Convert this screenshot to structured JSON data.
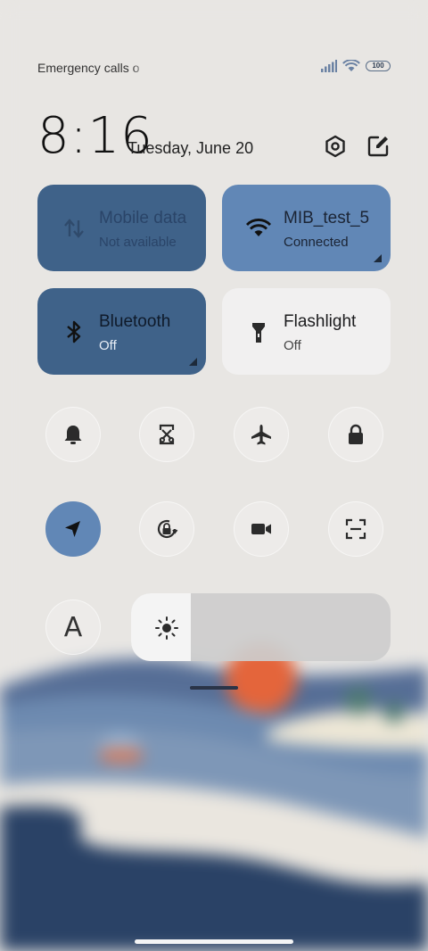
{
  "status_bar": {
    "carrier_text": "Emergency calls o",
    "battery_level": "100",
    "signal_icon": "signal-bars-icon",
    "wifi_icon": "wifi-icon"
  },
  "header": {
    "time": "8:16",
    "date": "Tuesday, June 20",
    "settings_icon": "settings-hex-icon",
    "edit_icon": "edit-icon"
  },
  "tiles": [
    {
      "label": "Mobile data",
      "sub": "Not available",
      "icon": "mobile-data-arrows-icon",
      "state": "disabled"
    },
    {
      "label": "MIB_test_5",
      "sub": "Connected",
      "icon": "wifi-icon",
      "state": "on"
    },
    {
      "label": "Bluetooth",
      "sub": "Off",
      "icon": "bluetooth-icon",
      "state": "off"
    },
    {
      "label": "Flashlight",
      "sub": "Off",
      "icon": "flashlight-icon",
      "state": "off"
    }
  ],
  "toggles_row1": [
    "bell-icon",
    "screenshot-icon",
    "airplane-icon",
    "lock-icon"
  ],
  "toggles_row2": [
    "location-icon",
    "rotation-lock-icon",
    "video-camera-icon",
    "scan-icon"
  ],
  "font_toggle": {
    "label": "A"
  },
  "brightness": {
    "level_percent": 23,
    "icon": "sun-icon"
  },
  "colors": {
    "accent": "#6187b6",
    "tile_dark": "#3f6289",
    "tile_light": "#f1f0f0"
  }
}
